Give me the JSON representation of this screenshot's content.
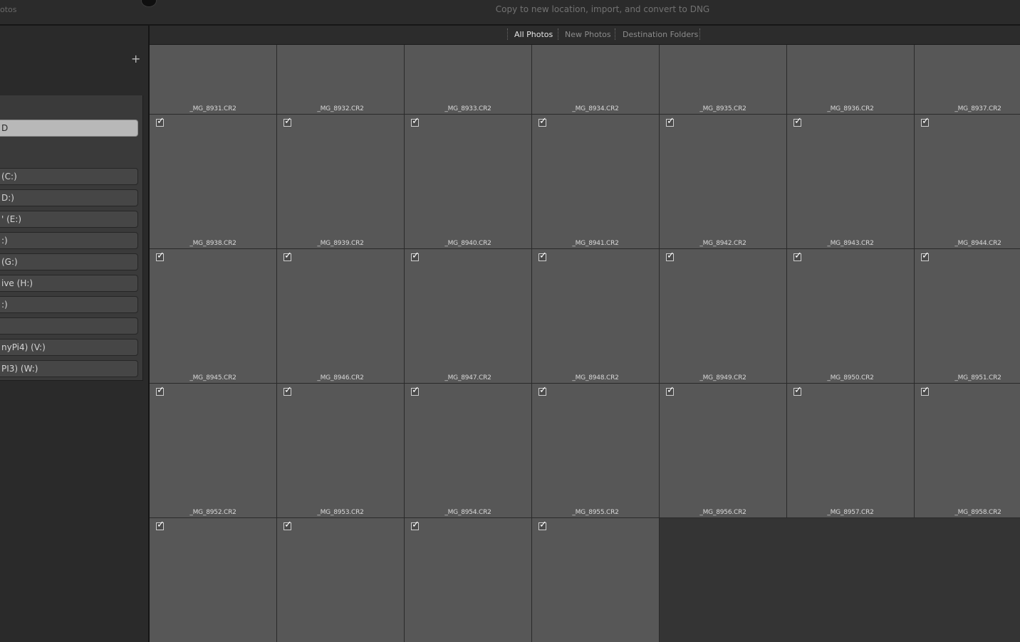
{
  "topbar": {
    "left_label": "otos",
    "title": "Copy to new location, import, and convert to DNG"
  },
  "left": {
    "plus_icon": "+",
    "sources": [
      {
        "label": "D",
        "selected": true
      },
      {
        "label": "(C:)",
        "selected": false
      },
      {
        "label": "D:)",
        "selected": false
      },
      {
        "label": "' (E:)",
        "selected": false
      },
      {
        "label": ":)",
        "selected": false
      },
      {
        "label": " (G:)",
        "selected": false
      },
      {
        "label": "ive (H:)",
        "selected": false
      },
      {
        "label": ":)",
        "selected": false
      },
      {
        "label": "",
        "selected": false
      },
      {
        "label": "nyPi4) (V:)",
        "selected": false
      },
      {
        "label": "PI3) (W:)",
        "selected": false
      }
    ]
  },
  "tabs": [
    {
      "label": "All Photos",
      "active": true
    },
    {
      "label": "New Photos",
      "active": false
    },
    {
      "label": "Destination Folders",
      "active": false
    }
  ],
  "photos": [
    {
      "name": "_MG_8931.CR2",
      "checked": false
    },
    {
      "name": "_MG_8932.CR2",
      "checked": false
    },
    {
      "name": "_MG_8933.CR2",
      "checked": false
    },
    {
      "name": "_MG_8934.CR2",
      "checked": false
    },
    {
      "name": "_MG_8935.CR2",
      "checked": false
    },
    {
      "name": "_MG_8936.CR2",
      "checked": false
    },
    {
      "name": "_MG_8937.CR2",
      "checked": false
    },
    {
      "name": "_MG_8938.CR2",
      "checked": true
    },
    {
      "name": "_MG_8939.CR2",
      "checked": true
    },
    {
      "name": "_MG_8940.CR2",
      "checked": true
    },
    {
      "name": "_MG_8941.CR2",
      "checked": true
    },
    {
      "name": "_MG_8942.CR2",
      "checked": true
    },
    {
      "name": "_MG_8943.CR2",
      "checked": true
    },
    {
      "name": "_MG_8944.CR2",
      "checked": true
    },
    {
      "name": "_MG_8945.CR2",
      "checked": true
    },
    {
      "name": "_MG_8946.CR2",
      "checked": true
    },
    {
      "name": "_MG_8947.CR2",
      "checked": true
    },
    {
      "name": "_MG_8948.CR2",
      "checked": true
    },
    {
      "name": "_MG_8949.CR2",
      "checked": true
    },
    {
      "name": "_MG_8950.CR2",
      "checked": true
    },
    {
      "name": "_MG_8951.CR2",
      "checked": true
    },
    {
      "name": "_MG_8952.CR2",
      "checked": true
    },
    {
      "name": "_MG_8953.CR2",
      "checked": true
    },
    {
      "name": "_MG_8954.CR2",
      "checked": true
    },
    {
      "name": "_MG_8955.CR2",
      "checked": true
    },
    {
      "name": "_MG_8956.CR2",
      "checked": true
    },
    {
      "name": "_MG_8957.CR2",
      "checked": true
    },
    {
      "name": "_MG_8958.CR2",
      "checked": true
    },
    {
      "name": "",
      "checked": true
    },
    {
      "name": "",
      "checked": true
    },
    {
      "name": "",
      "checked": true
    },
    {
      "name": "",
      "checked": true
    }
  ]
}
